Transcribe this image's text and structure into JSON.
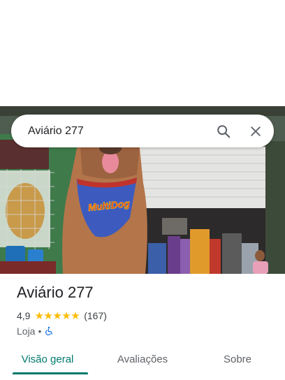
{
  "search": {
    "query": "Aviário 277"
  },
  "place": {
    "name": "Aviário 277",
    "rating": "4,9",
    "stars": "★★★★★",
    "review_count": "(167)",
    "category": "Loja",
    "separator": "•"
  },
  "photo": {
    "mascot_bandana_text": "MultiDog"
  },
  "tabs": [
    {
      "label": "Visão geral",
      "active": true
    },
    {
      "label": "Avaliações",
      "active": false
    },
    {
      "label": "Sobre",
      "active": false
    }
  ],
  "colors": {
    "accent": "#00796b",
    "star": "#fbbc04",
    "accessibility": "#1a73e8"
  },
  "icons": {
    "search": "search-icon",
    "close": "close-icon",
    "accessibility": "wheelchair-icon"
  }
}
